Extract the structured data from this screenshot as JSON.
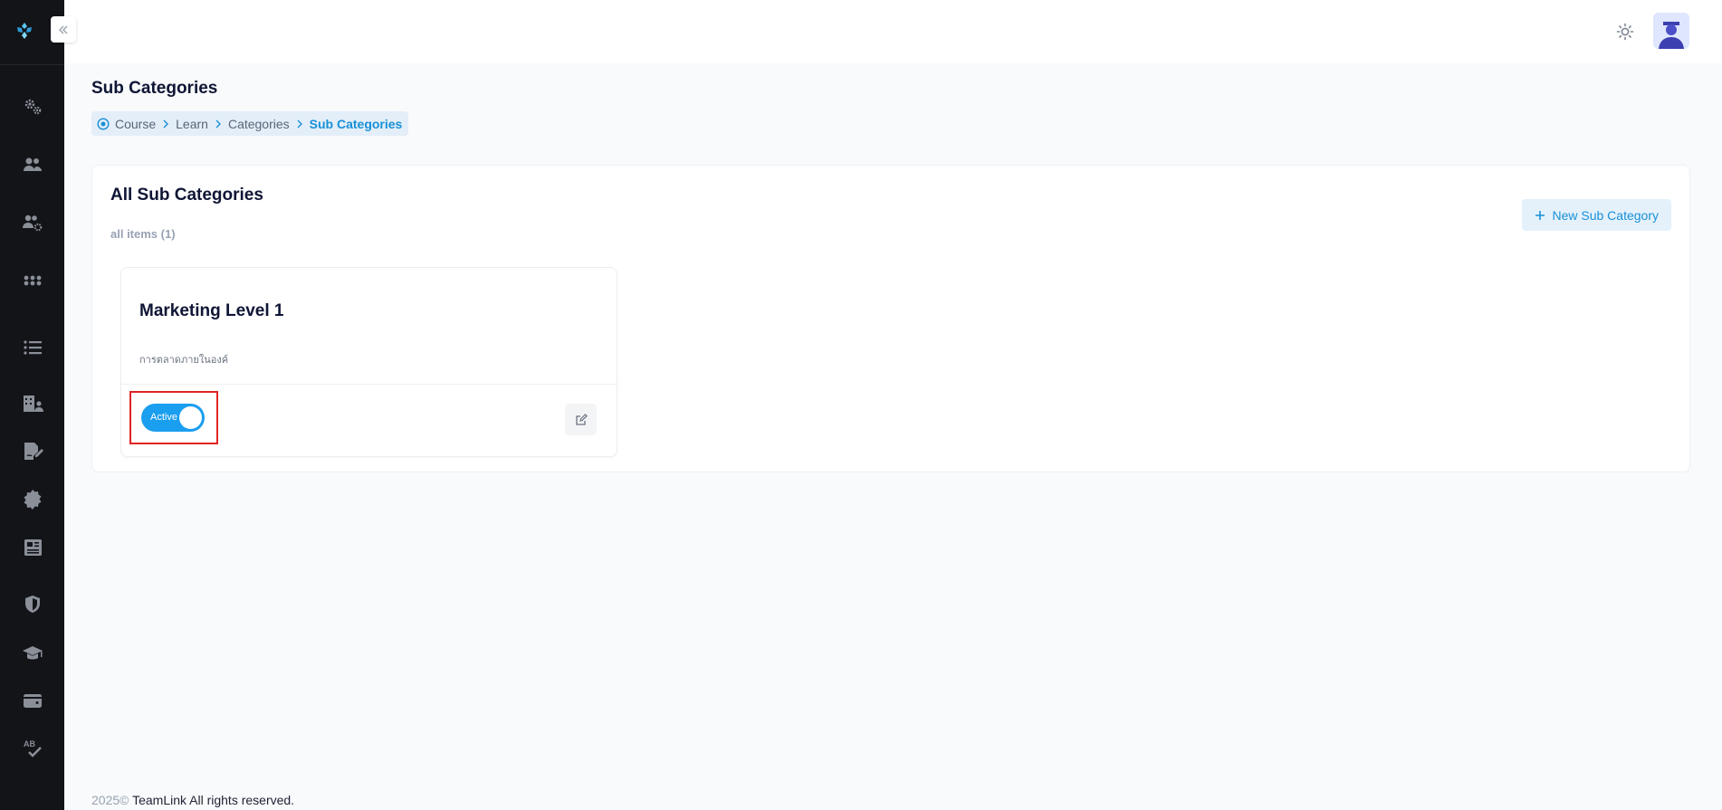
{
  "sidebar": {
    "logo": "app-logo",
    "items": [
      {
        "icon": "gears-icon"
      },
      {
        "icon": "users-icon"
      },
      {
        "icon": "users-settings-icon"
      },
      {
        "icon": "grid-dots-icon"
      },
      {
        "icon": "list-icon"
      },
      {
        "icon": "building-user-icon"
      },
      {
        "icon": "signature-icon"
      },
      {
        "icon": "badge-icon"
      },
      {
        "icon": "newspaper-icon"
      },
      {
        "icon": "shield-icon"
      },
      {
        "icon": "graduation-cap-icon"
      },
      {
        "icon": "wallet-icon"
      },
      {
        "icon": "spell-check-icon"
      }
    ]
  },
  "header": {
    "theme_icon": "sun-icon",
    "avatar": "user-avatar"
  },
  "page": {
    "title": "Sub Categories",
    "breadcrumb": [
      "Course",
      "Learn",
      "Categories",
      "Sub Categories"
    ]
  },
  "section": {
    "title": "All Sub Categories",
    "count_label": "all items (1)",
    "new_button_label": "New Sub Category"
  },
  "items": [
    {
      "title": "Marketing Level 1",
      "description": "การตลาดภายในองค์",
      "status_label": "Active",
      "active": true
    }
  ],
  "footer": {
    "year": "2025©",
    "text": " TeamLink All rights reserved."
  },
  "colors": {
    "accent": "#1a9ef0",
    "sidebar": "#121418",
    "highlight": "#e02424"
  }
}
